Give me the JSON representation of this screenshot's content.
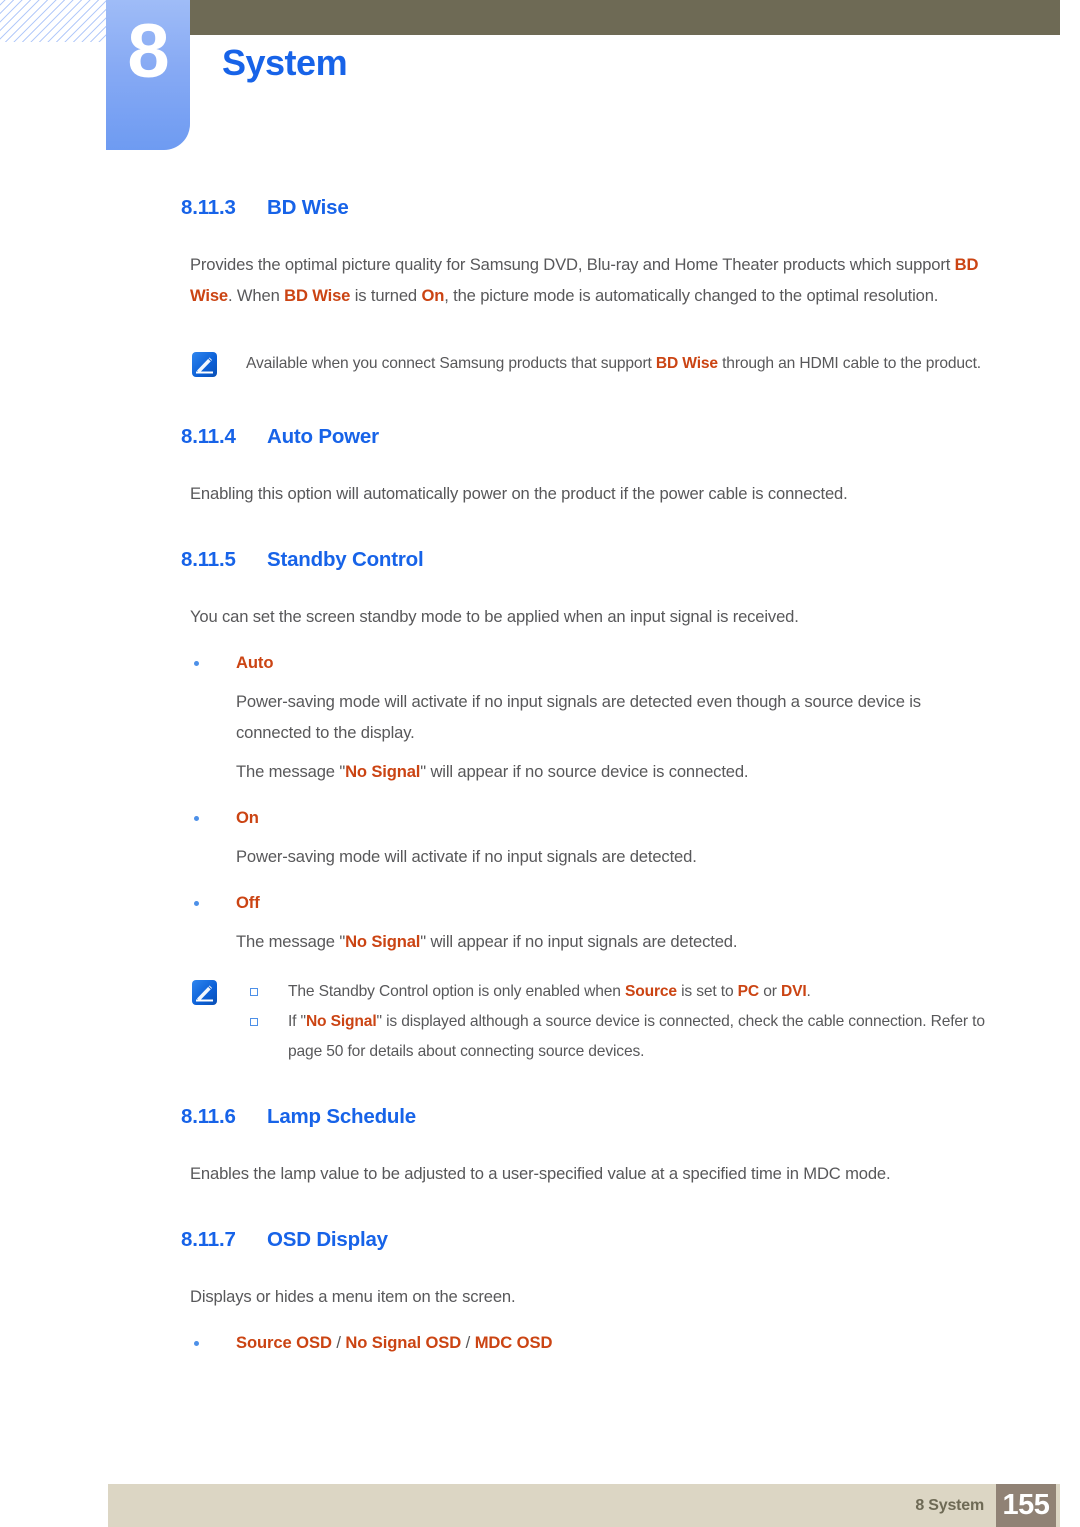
{
  "header": {
    "chapter_number": "8",
    "chapter_title": "System",
    "accent_blue": "#1763e8",
    "olive": "#6e6a55",
    "badge_blue": "#87aaf4"
  },
  "colors": {
    "highlight_orange": "#cb4413",
    "body_gray": "#58585a",
    "bullet_blue": "#4d90e8",
    "footer_bar": "#dcd6c4",
    "page_box": "#908275"
  },
  "sections": {
    "bd_wise": {
      "number": "8.11.3",
      "title": "BD Wise",
      "paragraph": {
        "p1": "Provides the optimal picture quality for Samsung DVD, Blu-ray and Home Theater products which support ",
        "hl1": "BD Wise",
        "p2": ". When ",
        "hl2": "BD Wise",
        "p3": " is turned ",
        "hl3": "On",
        "p4": ", the picture mode is automatically changed to the optimal resolution."
      },
      "note": {
        "icon": "note-pen-icon",
        "n1": "Available when you connect Samsung products that support ",
        "hl1": "BD Wise",
        "n2": " through an HDMI cable to the product."
      }
    },
    "auto_power": {
      "number": "8.11.4",
      "title": "Auto Power",
      "paragraph": "Enabling this option will automatically power on the product if the power cable is connected."
    },
    "standby_control": {
      "number": "8.11.5",
      "title": "Standby Control",
      "intro": "You can set the screen standby mode to be applied when an input signal is received.",
      "options": [
        {
          "label": "Auto",
          "lines": [
            {
              "t1": "Power-saving mode will activate if no input signals are detected even though a source device is connected to the display."
            },
            {
              "t1": "The message \"",
              "hl": "No Signal",
              "t2": "\" will appear if no source device is connected."
            }
          ]
        },
        {
          "label": "On",
          "lines": [
            {
              "t1": "Power-saving mode will activate if no input signals are detected."
            }
          ]
        },
        {
          "label": "Off",
          "lines": [
            {
              "t1": "The message \"",
              "hl": "No Signal",
              "t2": "\" will appear if no input signals are detected."
            }
          ]
        }
      ],
      "note": {
        "icon": "note-pen-icon",
        "items": [
          {
            "a1": "The Standby Control option is only enabled when ",
            "hl1": "Source",
            "a2": " is set to ",
            "hl2": "PC",
            "a3": " or ",
            "hl3": "DVI",
            "a4": "."
          },
          {
            "b1": "If \"",
            "hlb": "No Signal",
            "b2": "\" is displayed although a source device is connected, check the cable connection. Refer to page 50 for details about connecting source devices."
          }
        ]
      }
    },
    "lamp_schedule": {
      "number": "8.11.6",
      "title": "Lamp Schedule",
      "paragraph": "Enables the lamp value to be adjusted to a user-specified value at a specified time in MDC mode."
    },
    "osd_display": {
      "number": "8.11.7",
      "title": "OSD Display",
      "paragraph": "Displays or hides a menu item on the screen.",
      "bullet": {
        "i1": "Source OSD",
        "s1": " / ",
        "i2": "No Signal OSD",
        "s2": " / ",
        "i3": "MDC OSD"
      }
    }
  },
  "footer": {
    "label": "8 System",
    "page_number": "155"
  }
}
